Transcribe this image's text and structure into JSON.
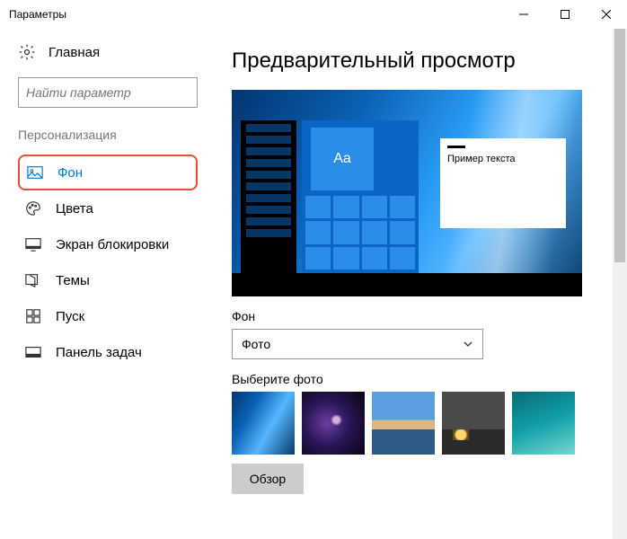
{
  "window": {
    "title": "Параметры"
  },
  "sidebar": {
    "home": "Главная",
    "search_placeholder": "Найти параметр",
    "section": "Персонализация",
    "items": [
      {
        "label": "Фон",
        "key": "background",
        "active": true
      },
      {
        "label": "Цвета",
        "key": "colors"
      },
      {
        "label": "Экран блокировки",
        "key": "lockscreen"
      },
      {
        "label": "Темы",
        "key": "themes"
      },
      {
        "label": "Пуск",
        "key": "start"
      },
      {
        "label": "Панель задач",
        "key": "taskbar"
      }
    ]
  },
  "main": {
    "heading": "Предварительный просмотр",
    "preview_sample_text": "Пример текста",
    "preview_tile_text": "Aa",
    "bg_label": "Фон",
    "bg_value": "Фото",
    "choose_label": "Выберите фото",
    "browse": "Обзор"
  }
}
